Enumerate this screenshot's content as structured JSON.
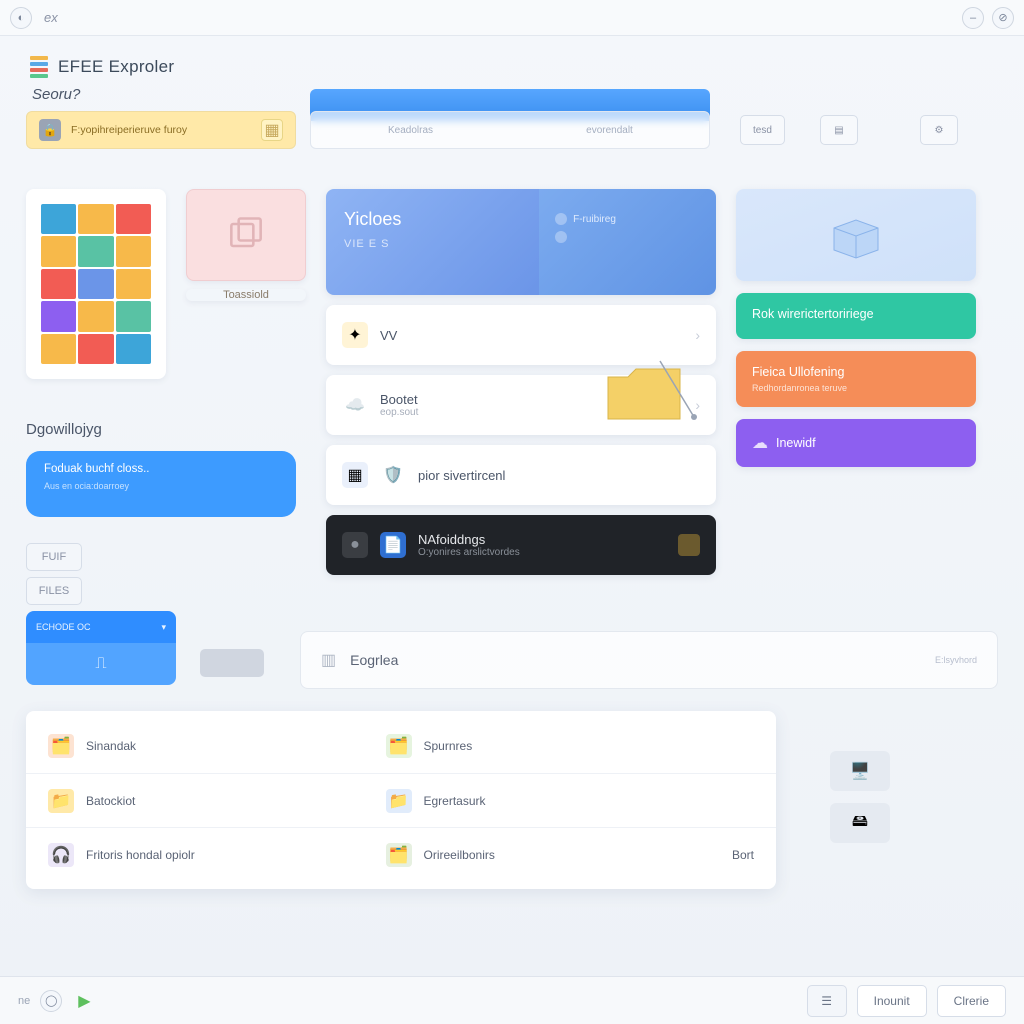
{
  "titlebar": {
    "tab": "ex"
  },
  "app": {
    "title": "EFEE Exproler"
  },
  "search_label": "Seoru?",
  "banner": {
    "text": "F:yopihreiperieruve furoy"
  },
  "topstrip": {
    "tab1": "Keadolras",
    "tab2": "evorendalt"
  },
  "top_buttons": {
    "b1": "tesd"
  },
  "tiles": {
    "pink_label": "Toassiold"
  },
  "center": {
    "blue": {
      "title": "Yicloes",
      "subtitle": "VIE E S",
      "r1": "F-ruibireg",
      "r2": ""
    },
    "row1": {
      "title": "VV",
      "subtitle": ""
    },
    "row2": {
      "title": "Bootet",
      "subtitle": "eop.sout"
    },
    "row3": {
      "title": "pior sivertircenl",
      "subtitle": ""
    },
    "row4": {
      "title": "NAfoiddngs",
      "subtitle": "O:yonires arslictvordes"
    }
  },
  "right": {
    "green": {
      "title": "Rok wirerictertoririege",
      "subtitle": ""
    },
    "orange": {
      "title": "Fieica Ullofening",
      "subtitle": "Redhordanronea teruve"
    },
    "purple": {
      "title": "Inewidf"
    }
  },
  "dropdowns": {
    "label": "Dgowillojyg",
    "pill_title": "Foduak buchf closs..",
    "pill_sub": "Aus en  ocia:doarroey"
  },
  "mini": {
    "m1": "FUIF",
    "m2": "FILES"
  },
  "split": {
    "top": "ECHODE OC"
  },
  "lowbar": {
    "text": "Eogrlea",
    "end": "E:lsyvhord"
  },
  "list": {
    "r1c1": "Sinandak",
    "r1c2": "Spurnres",
    "r2c1": "Batockiot",
    "r2c2": "Egrertasurk",
    "r3c1": "Fritoris hondal opiolr",
    "r3c2": "Orireeilbonirs",
    "r3c3": "Bort"
  },
  "footer": {
    "left": "ne",
    "b1": "Inounit",
    "b2": "Clrerie"
  }
}
